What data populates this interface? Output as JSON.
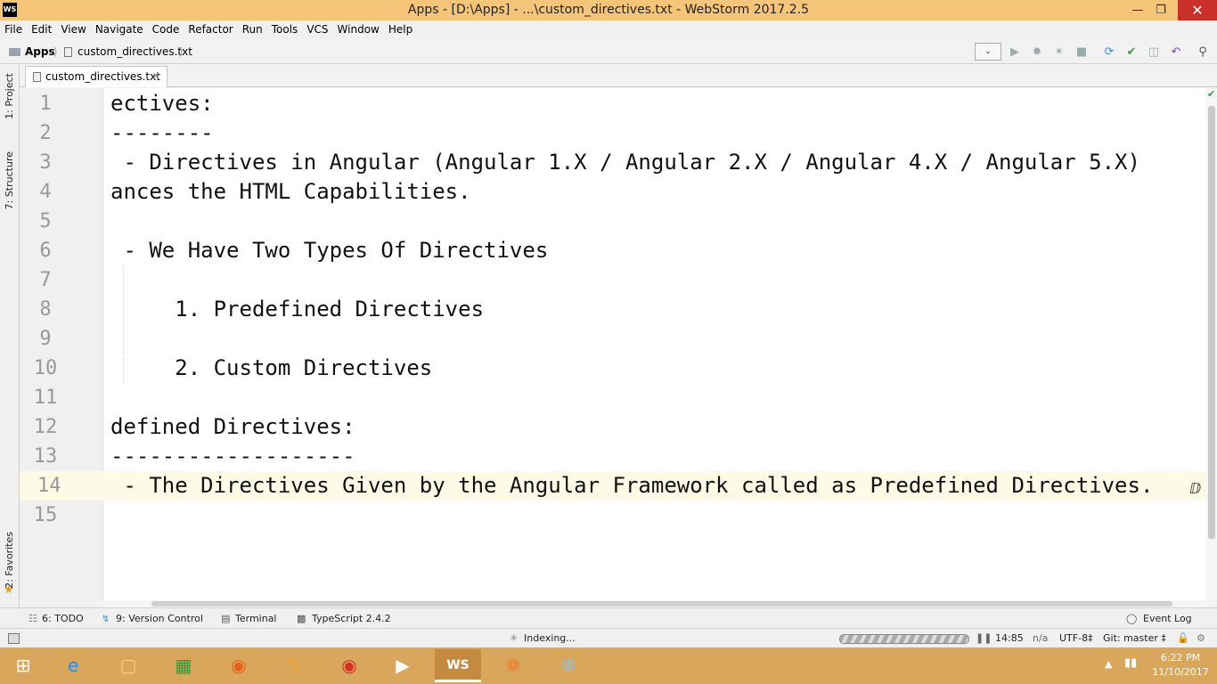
{
  "window": {
    "title": "Apps - [D:\\Apps] - ...\\custom_directives.txt - WebStorm 2017.2.5",
    "logo": "WS"
  },
  "menu": [
    "File",
    "Edit",
    "View",
    "Navigate",
    "Code",
    "Refactor",
    "Run",
    "Tools",
    "VCS",
    "Window",
    "Help"
  ],
  "breadcrumb": {
    "project": "Apps",
    "file": "custom_directives.txt"
  },
  "tab": {
    "label": "custom_directives.txt"
  },
  "side_tools": {
    "project": "1: Project",
    "structure": "7: Structure",
    "favorites": "2: Favorites"
  },
  "editor": {
    "lines": [
      {
        "n": "1",
        "text": "ectives:"
      },
      {
        "n": "2",
        "text": "--------"
      },
      {
        "n": "3",
        "text": " - Directives in Angular (Angular 1.X / Angular 2.X / Angular 4.X / Angular 5.X)"
      },
      {
        "n": "4",
        "text": "ances the HTML Capabilities."
      },
      {
        "n": "5",
        "text": ""
      },
      {
        "n": "6",
        "text": " - We Have Two Types Of Directives"
      },
      {
        "n": "7",
        "text": ""
      },
      {
        "n": "8",
        "text": "     1. Predefined Directives"
      },
      {
        "n": "9",
        "text": ""
      },
      {
        "n": "10",
        "text": "     2. Custom Directives"
      },
      {
        "n": "11",
        "text": ""
      },
      {
        "n": "12",
        "text": "defined Directives:"
      },
      {
        "n": "13",
        "text": "-------------------"
      },
      {
        "n": "14",
        "text": " - The Directives Given by the Angular Framework called as Predefined Directives."
      },
      {
        "n": "15",
        "text": ""
      }
    ]
  },
  "toolwindows": {
    "todo": "6: TODO",
    "vcs": "9: Version Control",
    "terminal": "Terminal",
    "typescript": "TypeScript 2.4.2",
    "eventlog": "Event Log"
  },
  "status": {
    "indexing": "Indexing...",
    "position": "14:85",
    "na": "n/a",
    "encoding": "UTF-8‡",
    "git": "Git: master ‡"
  },
  "clock": {
    "time": "6:22 PM",
    "date": "11/10/2017"
  },
  "colors": {
    "titlebar": "#f5c67a",
    "taskbar": "#d8a75c",
    "current_line": "#fdfae6"
  }
}
